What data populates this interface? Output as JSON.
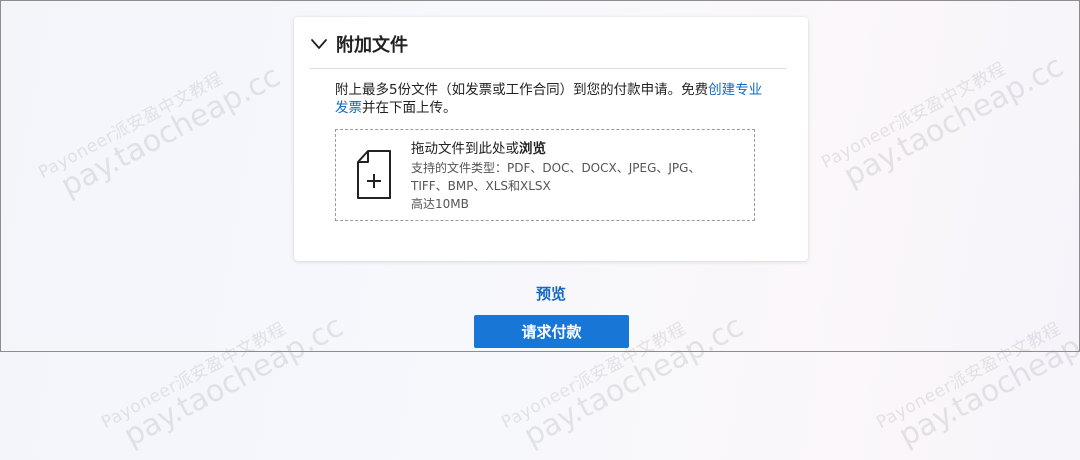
{
  "watermark": {
    "cn": "Payoneer派安盈中文教程",
    "domain": "pay.taocheap.cc"
  },
  "section": {
    "title": "附加文件",
    "collapse_icon": "chevron-down-icon"
  },
  "description": {
    "text_before": "附上最多5份文件（如发票或工作合同）到您的付款申请。免费",
    "link_text": "创建专业发票",
    "text_after": "并在下面上传。"
  },
  "dropzone": {
    "icon": "file-add-icon",
    "drag_text": "拖动文件到此处或",
    "browse_text": "浏览",
    "supported_types": "支持的文件类型：PDF、DOC、DOCX、JPEG、JPG、TIFF、BMP、XLS和XLSX",
    "max_size": "高达10MB"
  },
  "actions": {
    "preview_label": "预览",
    "request_label": "请求付款"
  },
  "colors": {
    "accent": "#1776d6",
    "link": "#1568c4"
  }
}
